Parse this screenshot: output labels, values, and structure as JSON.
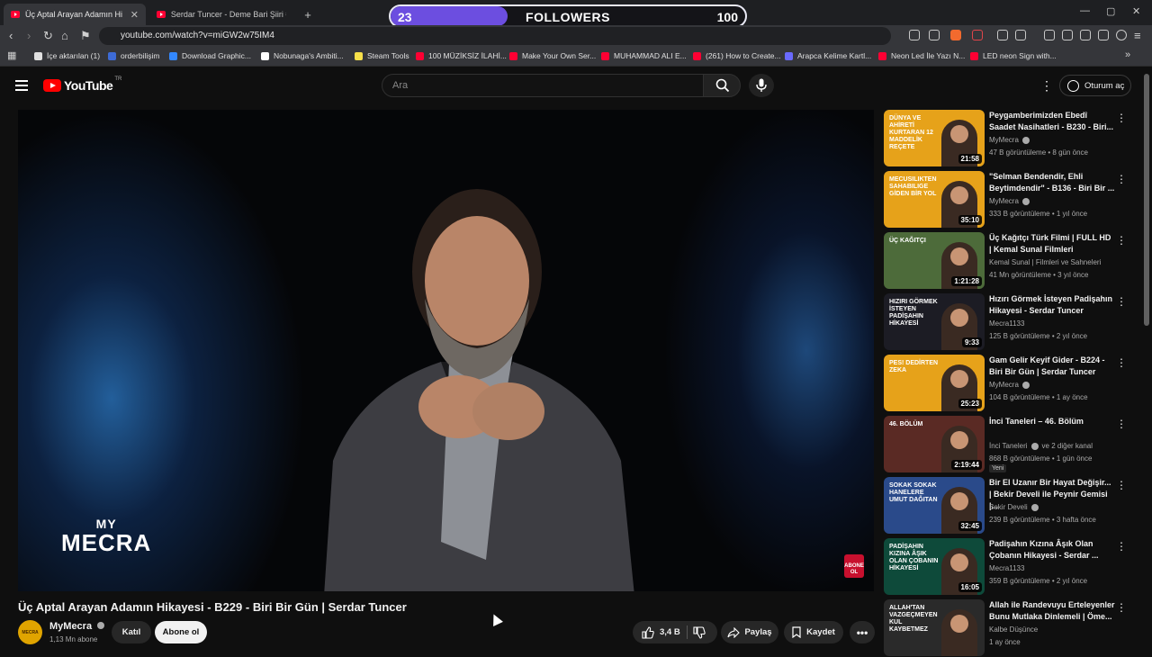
{
  "browser": {
    "tabs": [
      {
        "label": "Üç Aptal Arayan Adamın Hikay",
        "active": true
      },
      {
        "label": "Serdar Tuncer - Deme Bari Şiiri #Sho",
        "active": false
      }
    ],
    "new_tab": "+",
    "url": "youtube.com/watch?v=miGW2w75IM4",
    "window_controls": [
      "—",
      "▢",
      "✕"
    ]
  },
  "followers_overlay": {
    "current": "23",
    "label": "FOLLOWERS",
    "goal": "100",
    "progress": 0.23,
    "fill_color": "#6c4ee0"
  },
  "bookmarks": [
    {
      "label": "İçe aktarılan (1)",
      "color": "#e0e0e0"
    },
    {
      "label": "orderbilişim",
      "color": "#3d6bd6"
    },
    {
      "label": "Download Graphic...",
      "color": "#3388ff"
    },
    {
      "label": "Nobunaga's Ambiti...",
      "color": "#ffffff"
    },
    {
      "label": "Steam Tools",
      "color": "#f7e04a"
    },
    {
      "label": "100 MÜZİKSİZ İLAHİ...",
      "color": "#ff0033"
    },
    {
      "label": "Make Your Own Ser...",
      "color": "#ff0033"
    },
    {
      "label": "MUHAMMAD ALI E...",
      "color": "#ff0033"
    },
    {
      "label": "(261) How to Create...",
      "color": "#ff0033"
    },
    {
      "label": "Arapca Kelime Kartl...",
      "color": "#6a6aff"
    },
    {
      "label": "Neon Led İle Yazı N...",
      "color": "#ff0033"
    },
    {
      "label": "LED neon Sign with...",
      "color": "#ff0033"
    }
  ],
  "youtube": {
    "logo_text": "YouTube",
    "region": "TR",
    "search_placeholder": "Ara",
    "signin_label": "Oturum aç"
  },
  "video": {
    "watermark_line1": "MY",
    "watermark_line2": "MECRA",
    "corner_badge": "ABONE OL",
    "title": "Üç Aptal Arayan Adamın Hikayesi - B229 - Biri Bir Gün | Serdar Tuncer",
    "channel": "MyMecra",
    "channel_avatar_text": "MECRA",
    "subscribers": "1,13 Mn abone",
    "join_label": "Katıl",
    "subscribe_label": "Abone ol",
    "likes": "3,4 B",
    "share_label": "Paylaş",
    "save_label": "Kaydet",
    "more_label": "•••"
  },
  "recommendations": [
    {
      "thumb_text": "DÜNYA VE AHİRETİ KURTARAN 12 MADDELİK REÇETE",
      "thumb_color": "#e6a21a",
      "title": "Peygamberimizden Ebedî Saadet Nasihatleri - B230 - Biri...",
      "channel": "MyMecra",
      "verified": true,
      "meta": "47 B görüntüleme • 8 gün önce",
      "duration": "21:58"
    },
    {
      "thumb_text": "MECUSILIKTEN SAHABILIGE GİDEN BİR YOL",
      "thumb_color": "#e6a21a",
      "title": "\"Selman Bendendir, Ehli Beytimdendir\" - B136 - Biri Bir ...",
      "channel": "MyMecra",
      "verified": true,
      "meta": "333 B görüntüleme • 1 yıl önce",
      "duration": "35:10"
    },
    {
      "thumb_text": "ÜÇ KAĞITÇI",
      "thumb_color": "#4d6b3a",
      "title": "Üç Kağıtçı Türk Filmi | FULL HD | Kemal Sunal Filmleri",
      "channel": "Kemal Sunal | Filmleri ve Sahneleri",
      "verified": false,
      "meta": "41 Mn görüntüleme • 3 yıl önce",
      "duration": "1:21:28"
    },
    {
      "thumb_text": "HIZIRI GÖRMEK İSTEYEN PADİŞAHIN HİKAYESİ",
      "thumb_color": "#1c1c24",
      "title": "Hızırı Görmek İsteyen Padişahın Hikayesi - Serdar Tuncer",
      "channel": "Mecra1133",
      "verified": false,
      "meta": "125 B görüntüleme • 2 yıl önce",
      "duration": "9:33"
    },
    {
      "thumb_text": "PES! DEDİRTEN ZEKA",
      "thumb_color": "#e6a21a",
      "title": "Gam Gelir Keyif Gider - B224 - Biri Bir Gün | Serdar Tuncer",
      "channel": "MyMecra",
      "verified": true,
      "meta": "104 B görüntüleme • 1 ay önce",
      "duration": "25:23"
    },
    {
      "thumb_text": "46. BÖLÜM",
      "thumb_color": "#5a2a24",
      "title": "İnci Taneleri – 46. Bölüm",
      "channel": "İnci Taneleri",
      "verified": true,
      "channel_extra": "ve 2 diğer kanal",
      "meta": "868 B görüntüleme • 1 gün önce",
      "duration": "2:19:44",
      "badge": "Yeni"
    },
    {
      "thumb_text": "SOKAK SOKAK HANELERE UMUT DAĞITAN",
      "thumb_color": "#2a4a8a",
      "title": "Bir El Uzanır Bir Hayat Değişir... | Bekir Develi ile Peynir Gemisi |...",
      "channel": "Bekir Develi",
      "verified": true,
      "meta": "239 B görüntüleme • 3 hafta önce",
      "duration": "32:45"
    },
    {
      "thumb_text": "PADİŞAHIN KIZINA ÂŞIK OLAN ÇOBANIN HİKAYESİ",
      "thumb_color": "#0e4a3a",
      "title": "Padişahın Kızına Âşık Olan Çobanın Hikayesi - Serdar ...",
      "channel": "Mecra1133",
      "verified": false,
      "meta": "359 B görüntüleme • 2 yıl önce",
      "duration": "16:05"
    },
    {
      "thumb_text": "ALLAH'TAN VAZGEÇMEYEN KUL KAYBETMEZ",
      "thumb_color": "#2a2a2a",
      "title": "Allah ile Randevuyu Erteleyenler Bunu Mutlaka Dinlemeli | Öme...",
      "channel": "Kalbe Düşünce",
      "verified": false,
      "meta": "1 ay önce",
      "duration": ""
    }
  ]
}
